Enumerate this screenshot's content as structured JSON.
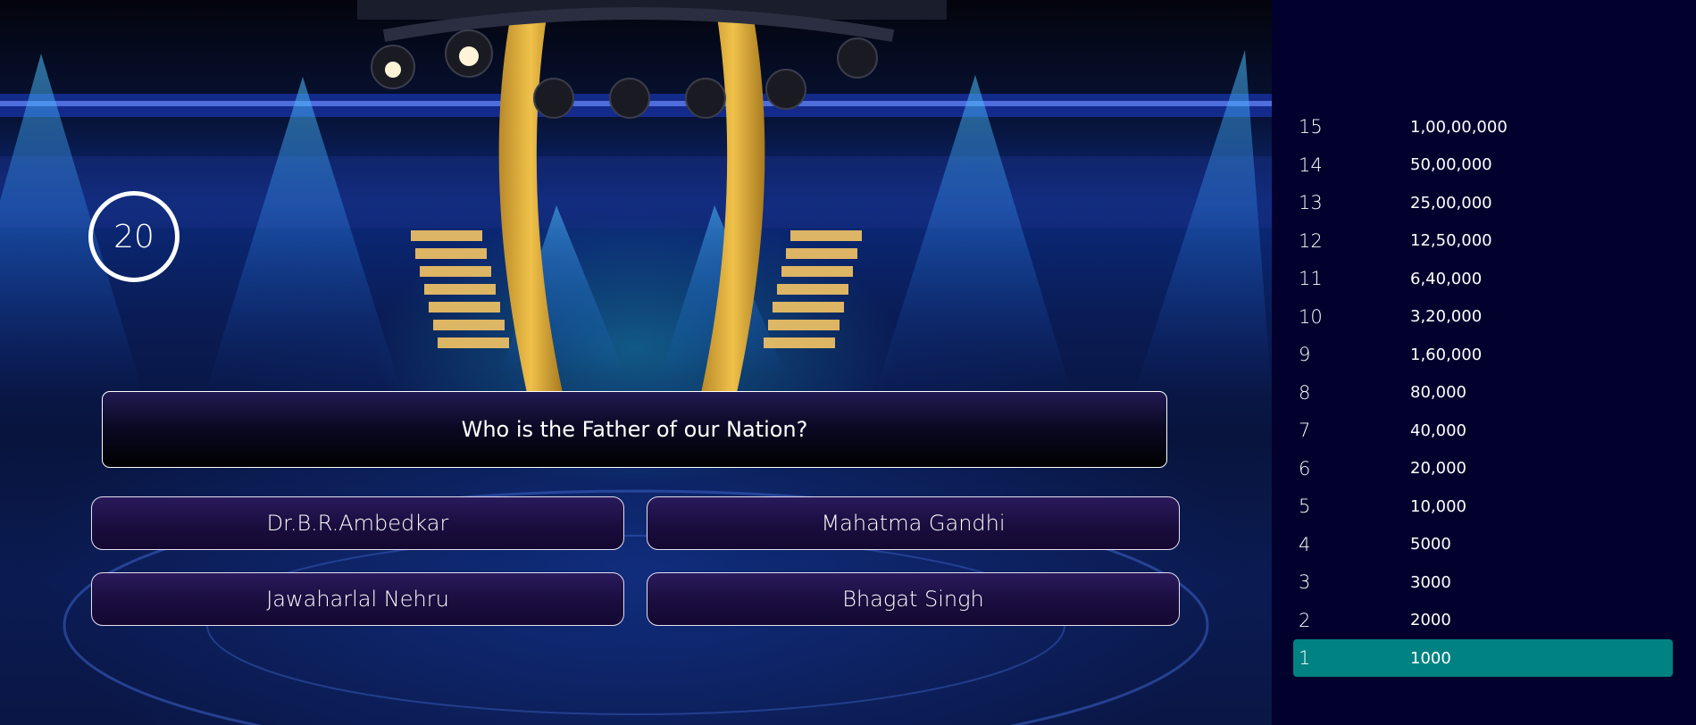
{
  "timer": {
    "seconds": "20"
  },
  "question": {
    "text": "Who is the Father of our Nation?"
  },
  "options": [
    {
      "label": "Dr.B.R.Ambedkar"
    },
    {
      "label": "Mahatma Gandhi"
    },
    {
      "label": "Jawaharlal Nehru"
    },
    {
      "label": "Bhagat Singh"
    }
  ],
  "ladder": {
    "current_level": "1",
    "active_color": "#008282",
    "rows": [
      {
        "level": "15",
        "amount": "1,00,00,000"
      },
      {
        "level": "14",
        "amount": "50,00,000"
      },
      {
        "level": "13",
        "amount": "25,00,000"
      },
      {
        "level": "12",
        "amount": "12,50,000"
      },
      {
        "level": "11",
        "amount": "6,40,000"
      },
      {
        "level": "10",
        "amount": "3,20,000"
      },
      {
        "level": "9",
        "amount": "1,60,000"
      },
      {
        "level": "8",
        "amount": "80,000"
      },
      {
        "level": "7",
        "amount": "40,000"
      },
      {
        "level": "6",
        "amount": "20,000"
      },
      {
        "level": "5",
        "amount": "10,000"
      },
      {
        "level": "4",
        "amount": "5000"
      },
      {
        "level": "3",
        "amount": "3000"
      },
      {
        "level": "2",
        "amount": "2000"
      },
      {
        "level": "1",
        "amount": "1000"
      }
    ]
  }
}
